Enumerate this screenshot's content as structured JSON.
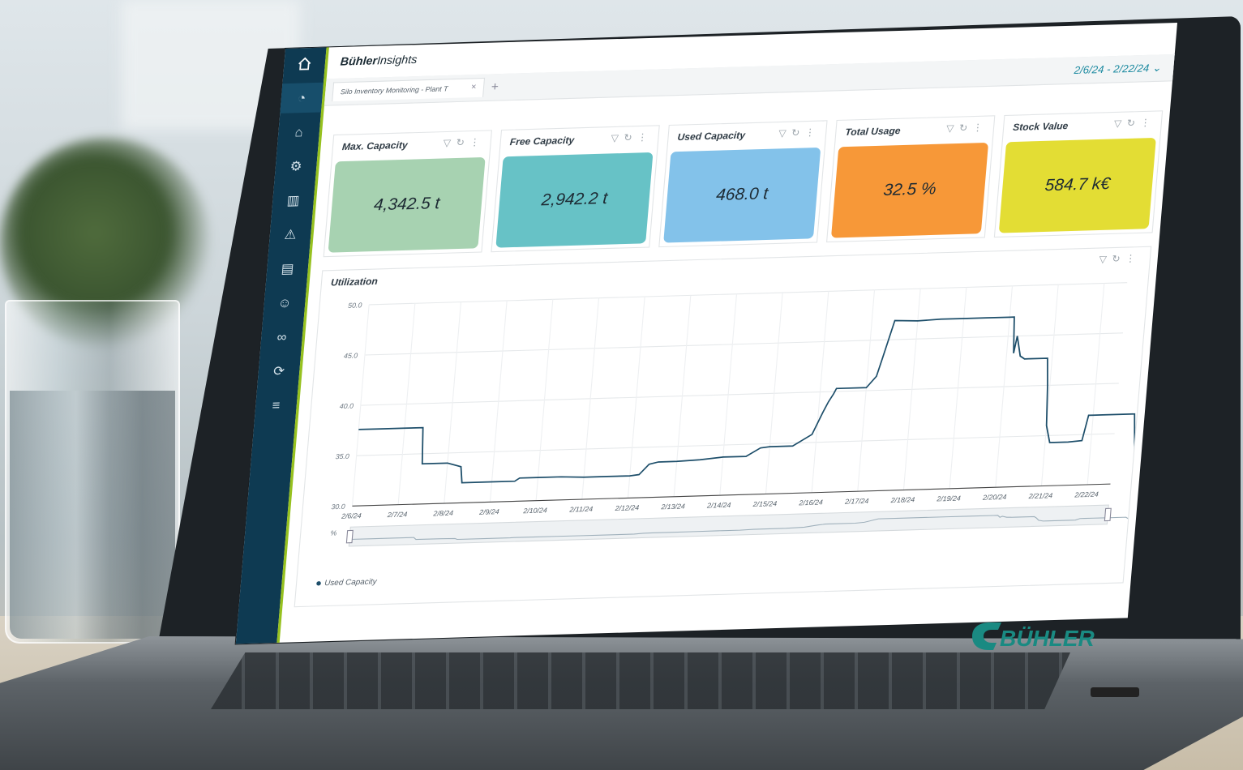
{
  "app": {
    "brand": "Bühler",
    "product": "Insights",
    "accent_color": "#0e3a52",
    "highlight_color": "#96c11f"
  },
  "sidebar": {
    "items": [
      {
        "icon": "home-icon"
      },
      {
        "icon": "dashboard-icon",
        "active": true
      },
      {
        "icon": "factory-icon"
      },
      {
        "icon": "settings-gear-icon"
      },
      {
        "icon": "bar-chart-icon"
      },
      {
        "icon": "warning-icon"
      },
      {
        "icon": "report-icon"
      },
      {
        "icon": "user-icon"
      },
      {
        "icon": "link-icon"
      },
      {
        "icon": "refresh-icon"
      },
      {
        "icon": "sliders-icon"
      }
    ]
  },
  "tabs": [
    {
      "label": "Silo Inventory Monitoring - Plant T",
      "close": "×"
    }
  ],
  "tab_add": "+",
  "date_range": "2/6/24 - 2/22/24",
  "kpis": [
    {
      "title": "Max. Capacity",
      "value": "4,342.5 t",
      "color": "#a7d2b1"
    },
    {
      "title": "Free Capacity",
      "value": "2,942.2 t",
      "color": "#67c2c6"
    },
    {
      "title": "Used Capacity",
      "value": "468.0 t",
      "color": "#83c2ea"
    },
    {
      "title": "Total Usage",
      "value": "32.5 %",
      "color": "#f79838"
    },
    {
      "title": "Stock Value",
      "value": "584.7 k€",
      "color": "#e3dd34"
    }
  ],
  "chart_panel": {
    "title": "Utilization",
    "zoom_label": "%",
    "legend": "Used Capacity"
  },
  "chart_data": {
    "type": "line",
    "title": "Utilization",
    "ylim": [
      30,
      50
    ],
    "y_ticks": [
      "50.0",
      "45.0",
      "40.0",
      "35.0",
      "30.0"
    ],
    "x_ticks": [
      "2/6/24",
      "2/7/24",
      "2/8/24",
      "2/9/24",
      "2/10/24",
      "2/11/24",
      "2/12/24",
      "2/13/24",
      "2/14/24",
      "2/15/24",
      "2/16/24",
      "2/17/24",
      "2/18/24",
      "2/19/24",
      "2/20/24",
      "2/21/24",
      "2/22/24"
    ],
    "grid": true,
    "series": [
      {
        "name": "Used Capacity",
        "color": "#1d4e6a",
        "x": [
          0,
          0.5,
          1.0,
          1.4,
          1.45,
          2.0,
          2.3,
          2.35,
          3.0,
          3.5,
          3.6,
          4.0,
          4.5,
          5.0,
          5.5,
          6.0,
          6.2,
          6.4,
          6.6,
          7.0,
          7.5,
          8.0,
          8.5,
          8.8,
          9.0,
          9.5,
          9.9,
          10.1,
          10.2,
          10.3,
          10.35,
          10.5,
          11.0,
          11.2,
          11.3,
          11.5,
          12.0,
          12.5,
          13.0,
          13.5,
          14.0,
          14.1,
          14.15,
          14.2,
          14.3,
          14.4,
          14.5,
          14.9,
          14.95,
          15.0,
          15.1,
          15.2,
          15.5,
          15.8,
          15.9,
          16.0,
          16.2,
          16.5,
          16.9,
          17.0,
          17.1,
          17.2,
          17.3,
          17.45
        ],
        "y": [
          37.6,
          37.6,
          37.6,
          37.6,
          34.0,
          34.0,
          33.6,
          32.0,
          32.0,
          32.0,
          32.3,
          32.3,
          32.3,
          32.2,
          32.2,
          32.2,
          32.3,
          33.3,
          33.5,
          33.5,
          33.6,
          33.8,
          33.8,
          34.6,
          34.7,
          34.7,
          35.8,
          38.0,
          39.0,
          39.8,
          40.3,
          40.3,
          40.3,
          41.4,
          43.2,
          46.9,
          46.8,
          46.9,
          46.9,
          46.9,
          46.9,
          46.9,
          43.3,
          45.0,
          43.0,
          42.7,
          42.7,
          42.7,
          40.0,
          36.0,
          34.3,
          34.3,
          34.3,
          34.4,
          36.9,
          36.9,
          36.9,
          36.9,
          36.9,
          31.5,
          32.0,
          31.6,
          32.1,
          31.7
        ]
      }
    ]
  }
}
